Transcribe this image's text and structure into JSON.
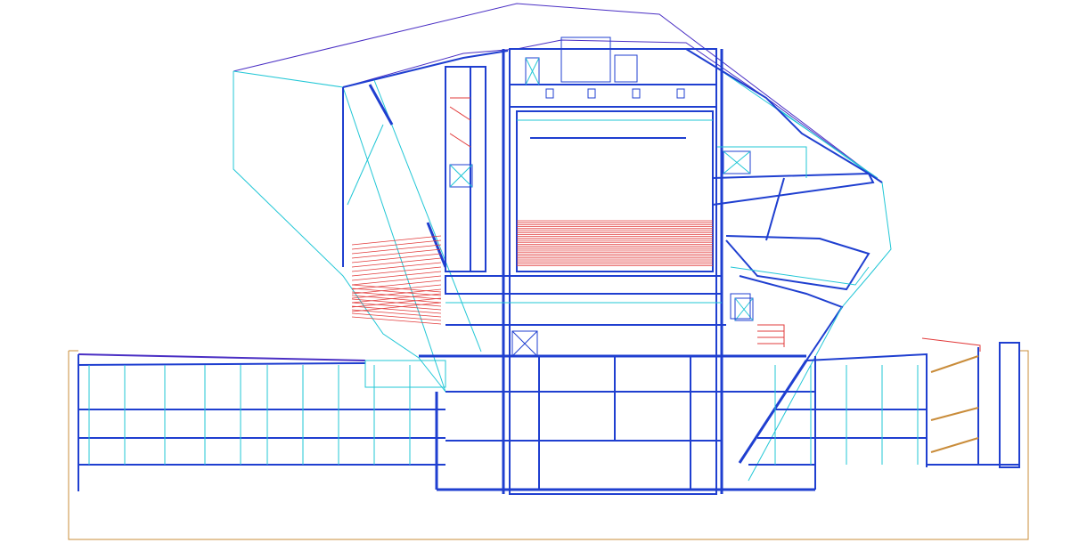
{
  "drawing": {
    "kind": "architectural-section",
    "colors": {
      "structure": "#1f3fd0",
      "secondary": "#22c7d6",
      "envelope": "#4a2fc4",
      "seating": "#e23b3b",
      "ground": "#c98c3a"
    },
    "icons": [
      "section-drawing"
    ]
  }
}
